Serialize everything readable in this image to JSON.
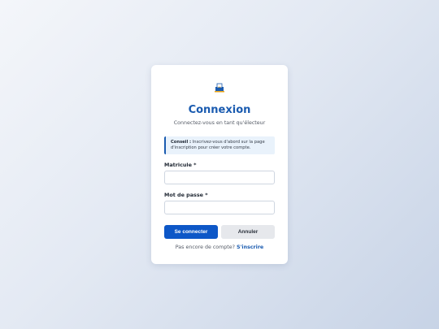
{
  "login": {
    "title": "Connexion",
    "subtitle": "Connectez-vous en tant qu'électeur",
    "tip": {
      "prefix": "Conseil :",
      "text": " Inscrivez-vous d'abord sur la page d'inscription pour créer votre compte."
    },
    "fields": {
      "matricule_label": "Matricule *",
      "matricule_value": "",
      "password_label": "Mot de passe *",
      "password_value": ""
    },
    "buttons": {
      "submit": "Se connecter",
      "cancel": "Annuler"
    },
    "signup": {
      "prompt": "Pas encore de compte? ",
      "link": "S'inscrire"
    }
  },
  "colors": {
    "primary": "#0d57c7",
    "title": "#1a5bb0",
    "tip_bg": "#e9f2fb"
  },
  "icons": {
    "logo": "ballot-logo-icon"
  }
}
